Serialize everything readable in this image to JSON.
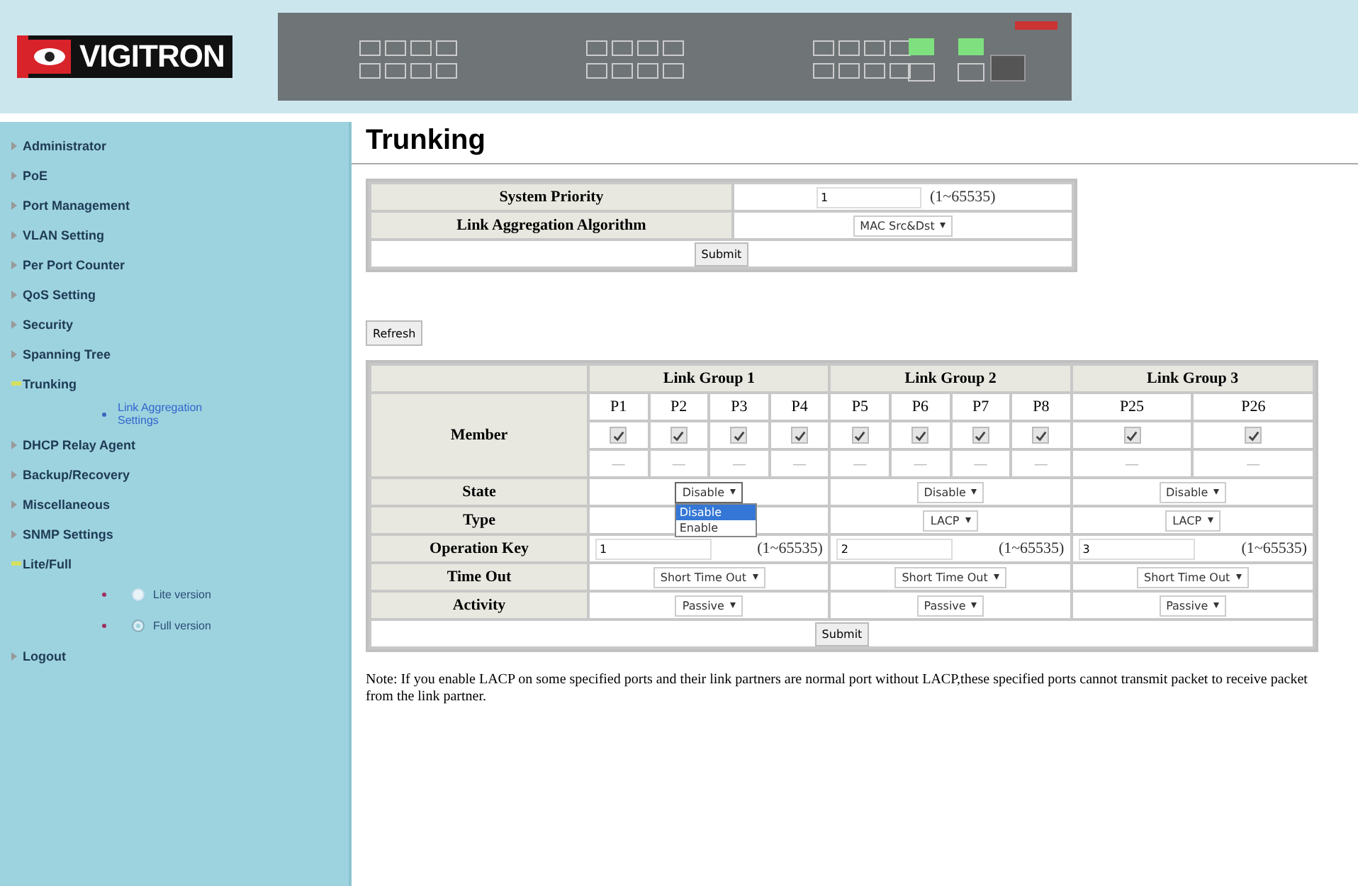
{
  "header": {
    "logo": "VIGITRON"
  },
  "sidebar": {
    "items": [
      {
        "label": "Administrator",
        "expanded": false
      },
      {
        "label": "PoE",
        "expanded": false
      },
      {
        "label": "Port Management",
        "expanded": false
      },
      {
        "label": "VLAN Setting",
        "expanded": false
      },
      {
        "label": "Per Port Counter",
        "expanded": false
      },
      {
        "label": "QoS Setting",
        "expanded": false
      },
      {
        "label": "Security",
        "expanded": false
      },
      {
        "label": "Spanning Tree",
        "expanded": false
      },
      {
        "label": "Trunking",
        "expanded": true,
        "children": [
          {
            "kind": "link",
            "label": "Link Aggregation Settings"
          }
        ]
      },
      {
        "label": "DHCP Relay Agent",
        "expanded": false
      },
      {
        "label": "Backup/Recovery",
        "expanded": false
      },
      {
        "label": "Miscellaneous",
        "expanded": false
      },
      {
        "label": "SNMP Settings",
        "expanded": false
      },
      {
        "label": "Lite/Full",
        "expanded": true,
        "children": [
          {
            "kind": "radio",
            "label": "Lite version",
            "selected": false
          },
          {
            "kind": "radio",
            "label": "Full version",
            "selected": true
          }
        ]
      },
      {
        "label": "Logout",
        "expanded": false
      }
    ]
  },
  "page": {
    "title": "Trunking"
  },
  "system_table": {
    "priority_label": "System Priority",
    "priority_value": "1",
    "priority_range": "(1~65535)",
    "algorithm_label": "Link Aggregation Algorithm",
    "algorithm_value": "MAC Src&Dst",
    "submit": "Submit"
  },
  "refresh_button": "Refresh",
  "group_table": {
    "row_labels": {
      "member": "Member",
      "state": "State",
      "type": "Type",
      "operation_key": "Operation Key",
      "time_out": "Time Out",
      "activity": "Activity"
    },
    "groups": [
      {
        "title": "Link Group 1",
        "ports": [
          {
            "name": "P1",
            "checked": true,
            "status": "—"
          },
          {
            "name": "P2",
            "checked": true,
            "status": "—"
          },
          {
            "name": "P3",
            "checked": true,
            "status": "—"
          },
          {
            "name": "P4",
            "checked": true,
            "status": "—"
          }
        ],
        "state": "Disable",
        "state_open": true,
        "state_options": [
          {
            "label": "Disable",
            "selected": true
          },
          {
            "label": "Enable",
            "selected": false
          }
        ],
        "operation_key": "1",
        "key_range": "(1~65535)",
        "time_out": "Short Time Out",
        "activity": "Passive"
      },
      {
        "title": "Link Group 2",
        "ports": [
          {
            "name": "P5",
            "checked": true,
            "status": "—"
          },
          {
            "name": "P6",
            "checked": true,
            "status": "—"
          },
          {
            "name": "P7",
            "checked": true,
            "status": "—"
          },
          {
            "name": "P8",
            "checked": true,
            "status": "—"
          }
        ],
        "state": "Disable",
        "state_open": false,
        "type": "LACP",
        "operation_key": "2",
        "key_range": "(1~65535)",
        "time_out": "Short Time Out",
        "activity": "Passive"
      },
      {
        "title": "Link Group 3",
        "ports": [
          {
            "name": "P25",
            "checked": true,
            "status": "—"
          },
          {
            "name": "P26",
            "checked": true,
            "status": "—"
          }
        ],
        "state": "Disable",
        "state_open": false,
        "type": "LACP",
        "operation_key": "3",
        "key_range": "(1~65535)",
        "time_out": "Short Time Out",
        "activity": "Passive"
      }
    ],
    "submit": "Submit"
  },
  "note": "Note: If you enable LACP on some specified ports and their link partners are normal port without LACP,these specified ports cannot transmit packet to receive packet from the link partner."
}
